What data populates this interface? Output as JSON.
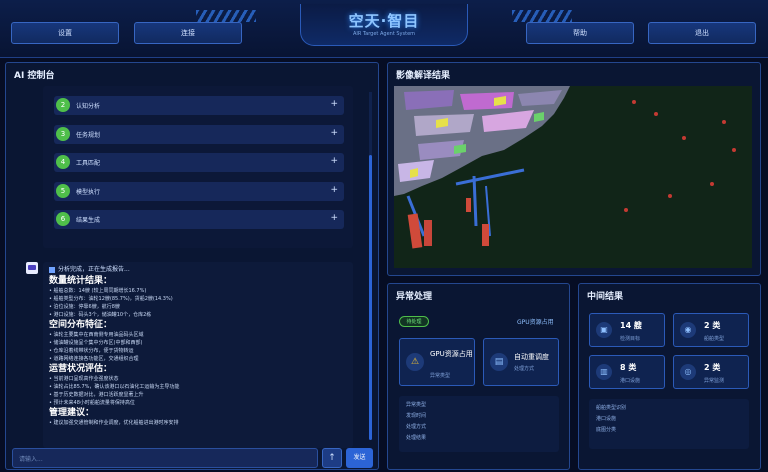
{
  "header": {
    "logo_title": "空天·智目",
    "logo_subtitle": "AIR Target Agent System",
    "nav": [
      "设置",
      "连接",
      "帮助",
      "退出"
    ]
  },
  "console": {
    "title": "AI 控制台",
    "steps": [
      {
        "num": "2",
        "label": "认知分析"
      },
      {
        "num": "3",
        "label": "任务规划"
      },
      {
        "num": "4",
        "label": "工具匹配"
      },
      {
        "num": "5",
        "label": "模型执行"
      },
      {
        "num": "6",
        "label": "结果生成"
      }
    ],
    "expand_glyph": "+",
    "status": "分析完成，正在生成报告...",
    "report": [
      {
        "type": "head",
        "text": "数量统计结果："
      },
      {
        "type": "line",
        "text": "• 船舶总数：14艘 (较上周同期增长16.7%)"
      },
      {
        "type": "line",
        "text": "• 船舶类型分布：油轮12艘(85.7%)，货船2艘(14.3%)"
      },
      {
        "type": "line",
        "text": "• 泊位设施：停靠6艘，航行8艘"
      },
      {
        "type": "line",
        "text": "• 港口设施：码头3个，储油罐10个，仓库2栋"
      },
      {
        "type": "head",
        "text": "空间分布特征："
      },
      {
        "type": "line",
        "text": "• 油轮主要集中在西南侧专用油品码头区域"
      },
      {
        "type": "line",
        "text": "• 储油罐设施呈个集中分布区(中部和西部)"
      },
      {
        "type": "line",
        "text": "• 仓库沿着线带状分布，便于货物转运"
      },
      {
        "type": "line",
        "text": "• 道路网络连接各功能区，交通组织合理"
      },
      {
        "type": "head",
        "text": "运营状况评估："
      },
      {
        "type": "line",
        "text": "• 当前港口呈现高作业强度状态"
      },
      {
        "type": "line",
        "text": "• 油轮占比85.7%，确认该港口以石油化工运输为主导功能"
      },
      {
        "type": "line",
        "text": "• 基于历史数据对比，港口活跃度显著上升"
      },
      {
        "type": "line",
        "text": "• 预计未来48小时船舶流量将保持高位"
      },
      {
        "type": "head",
        "text": "管理建议："
      },
      {
        "type": "line",
        "text": "• 建议加强交通管制和作业调度，优化船舶进出港时序安排"
      }
    ],
    "input_placeholder": "请输入...",
    "upload_glyph": "↑",
    "send_label": "发送"
  },
  "image_panel": {
    "title": "影像解译结果"
  },
  "anomaly": {
    "title": "异常处理",
    "badge": "待处理",
    "badge_right": "GPU资源占用",
    "cards": [
      {
        "title": "GPU资源占用",
        "sub": "异常类型",
        "icon": "⚠"
      },
      {
        "title": "自动重调度",
        "sub": "处理方式",
        "icon": "▤"
      }
    ],
    "list": [
      "异常类型",
      "发现时间",
      "处理方式",
      "处理结果"
    ]
  },
  "intermediate": {
    "title": "中间结果",
    "metrics": [
      {
        "value": "14 艘",
        "label": "检测目标",
        "icon": "▣"
      },
      {
        "value": "2 类",
        "label": "船舶类型",
        "icon": "◉"
      },
      {
        "value": "8 类",
        "label": "港口设施",
        "icon": "▥"
      },
      {
        "value": "2 类",
        "label": "异常监测",
        "icon": "◎"
      }
    ],
    "list": [
      "船舶类型识别",
      "港口设施",
      "底图分类"
    ]
  },
  "colors": {
    "accent": "#2c64d6",
    "success": "#4fbf4a",
    "warning": "#f2c230",
    "panel": "#0a1633"
  }
}
